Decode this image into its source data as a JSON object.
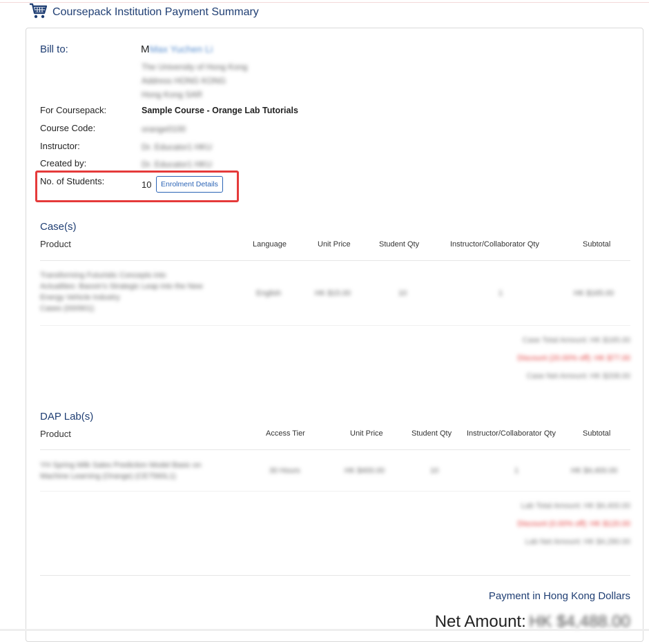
{
  "page": {
    "title": "Coursepack Institution Payment Summary"
  },
  "bill": {
    "label": "Bill to:",
    "name_initial": "M",
    "name_rest": "Max Yuchen Li",
    "address_lines": [
      "The University of Hong Kong",
      "Address HONG KONG",
      "Hong Kong SAR"
    ]
  },
  "details": {
    "coursepack_label": "For Coursepack:",
    "coursepack_value": "Sample Course - Orange Lab Tutorials",
    "course_code_label": "Course Code:",
    "course_code_value": "orange0100",
    "instructor_label": "Instructor:",
    "instructor_value": "Dr. Educator1 HKU",
    "created_by_label": "Created by:",
    "created_by_value": "Dr. Educator1 HKU",
    "students_label": "No. of Students:",
    "students_value": "10",
    "enrolment_button": "Enrolment Details"
  },
  "cases": {
    "title": "Case(s)",
    "headers": {
      "product": "Product",
      "language": "Language",
      "unit_price": "Unit Price",
      "student_qty": "Student Qty",
      "instructor_qty": "Instructor/Collaborator Qty",
      "subtotal": "Subtotal"
    },
    "rows": [
      {
        "product_lines": [
          "Transforming Futuristic Concepts into",
          "Actualities: Baoxin's Strategic Leap into the New",
          "Energy Vehicle Industry",
          "Cases (000901)"
        ],
        "language": "English",
        "unit_price": "HK $15.00",
        "student_qty": "10",
        "instructor_qty": "1",
        "subtotal": "HK $165.00"
      }
    ],
    "summary": {
      "total": "Case Total Amount: HK $165.00",
      "discount": "Discount (20.00% off): HK $77.00",
      "net": "Case Net Amount: HK $208.00"
    }
  },
  "labs": {
    "title": "DAP Lab(s)",
    "headers": {
      "product": "Product",
      "access_tier": "Access Tier",
      "unit_price": "Unit Price",
      "student_qty": "Student Qty",
      "instructor_qty": "Instructor/Collaborator Qty",
      "subtotal": "Subtotal"
    },
    "rows": [
      {
        "product_lines": [
          "YH Spring Milk Sales Prediction Model Basic on",
          "Machine Learning (Orange) (CE7560L1)"
        ],
        "access_tier": "30 Hours",
        "unit_price": "HK $400.00",
        "student_qty": "10",
        "instructor_qty": "1",
        "subtotal": "HK $4,400.00"
      }
    ],
    "summary": {
      "total": "Lab Total Amount: HK $4,400.00",
      "discount": "Discount (0.00% off): HK $120.00",
      "net": "Lab Net Amount: HK $4,280.00"
    }
  },
  "payment": {
    "currency_label": "Payment in Hong Kong Dollars",
    "net_label": "Net Amount:",
    "net_value": "HK $4,488.00"
  },
  "colors": {
    "title_blue": "#1f3e73",
    "link_blue": "#2a63b5",
    "highlight_red": "#e53a3a",
    "discount_red": "#e23b3b"
  }
}
